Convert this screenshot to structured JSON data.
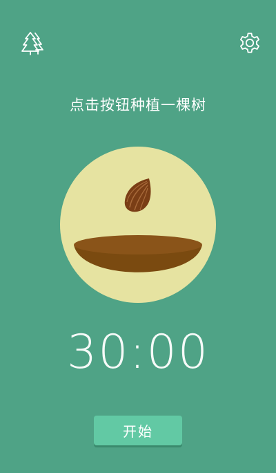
{
  "header": {
    "forest_icon": "forest-icon",
    "settings_icon": "gear-icon"
  },
  "prompt_text": "点击按钮种植一棵树",
  "illustration": {
    "circle_color": "#e6e3a1",
    "pot_color": "#7a4a10",
    "pot_rim_color": "#8a5419",
    "seed_color": "#7a3e16"
  },
  "timer": {
    "value": "30:00"
  },
  "start_button": {
    "label": "开始"
  },
  "colors": {
    "background": "#4fa386",
    "button": "#62c9a4"
  }
}
